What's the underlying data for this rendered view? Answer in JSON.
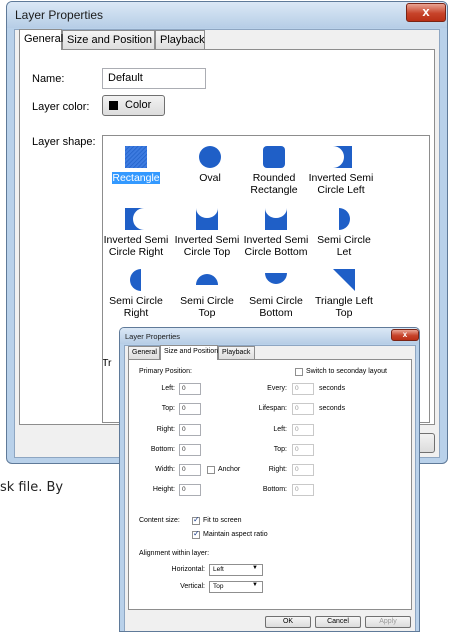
{
  "window_main": {
    "title": "Layer Properties",
    "close": "x",
    "tabs": [
      "General",
      "Size and Position",
      "Playback"
    ],
    "name_label": "Name:",
    "name_value": "Default",
    "color_label": "Layer color:",
    "color_button": "Color",
    "color_swatch": "#000000",
    "shape_label": "Layer shape:",
    "shapes": [
      {
        "label": "Rectangle",
        "icon": "rectangle-icon"
      },
      {
        "label": "Oval",
        "icon": "oval-icon"
      },
      {
        "label": "Rounded Rectangle",
        "icon": "rounded-rectangle-icon"
      },
      {
        "label": "Inverted Semi Circle Left",
        "icon": "inverted-semi-circle-left-icon"
      },
      {
        "label": "Inverted Semi Circle Right",
        "icon": "inverted-semi-circle-right-icon"
      },
      {
        "label": "Inverted Semi Circle Top",
        "icon": "inverted-semi-circle-top-icon"
      },
      {
        "label": "Inverted Semi Circle Bottom",
        "icon": "inverted-semi-circle-bottom-icon"
      },
      {
        "label": "Semi Circle Let",
        "icon": "semi-circle-left-icon"
      },
      {
        "label": "Semi Circle Right",
        "icon": "semi-circle-right-icon"
      },
      {
        "label": "Semi Circle Top",
        "icon": "semi-circle-top-icon"
      },
      {
        "label": "Semi Circle Bottom",
        "icon": "semi-circle-bottom-icon"
      },
      {
        "label": "Triangle Left Top",
        "icon": "triangle-left-top-icon"
      }
    ],
    "partial_label": "Tr",
    "shape_color": "#1f5fc7",
    "selection_color": "#3399ff"
  },
  "background_text": "sk file. By",
  "window_small": {
    "title": "Layer Properties",
    "close": "x",
    "tabs": [
      "General",
      "Size and Position",
      "Playback"
    ],
    "primary_position": "Primary Position:",
    "switch_label": "Switch to seconday layout",
    "left_label": "Left:",
    "left_value": "0",
    "top_label": "Top:",
    "top_value": "0",
    "right_label": "Right:",
    "right_value": "0",
    "bottom_label": "Bottom:",
    "bottom_value": "0",
    "width_label": "Width:",
    "width_value": "0",
    "anchor_label": "Anchor",
    "height_label": "Height:",
    "height_value": "0",
    "every_label": "Every:",
    "every_value": "0",
    "every_unit": "seconds",
    "lifespan_label": "Lifespan:",
    "lifespan_value": "0",
    "lifespan_unit": "seconds",
    "sec_left_label": "Left:",
    "sec_left_value": "0",
    "sec_top_label": "Top:",
    "sec_top_value": "0",
    "sec_right_label": "Right:",
    "sec_right_value": "0",
    "sec_bottom_label": "Bottom:",
    "sec_bottom_value": "0",
    "content_size_label": "Content size:",
    "fit_label": "Fit to screen",
    "aspect_label": "Maintain aspect ratio",
    "alignment_label": "Alignment within layer:",
    "horizontal_label": "Horizontal:",
    "horizontal_value": "Left",
    "vertical_label": "Vertical:",
    "vertical_value": "Top",
    "ok": "OK",
    "cancel": "Cancel",
    "apply": "Apply"
  }
}
